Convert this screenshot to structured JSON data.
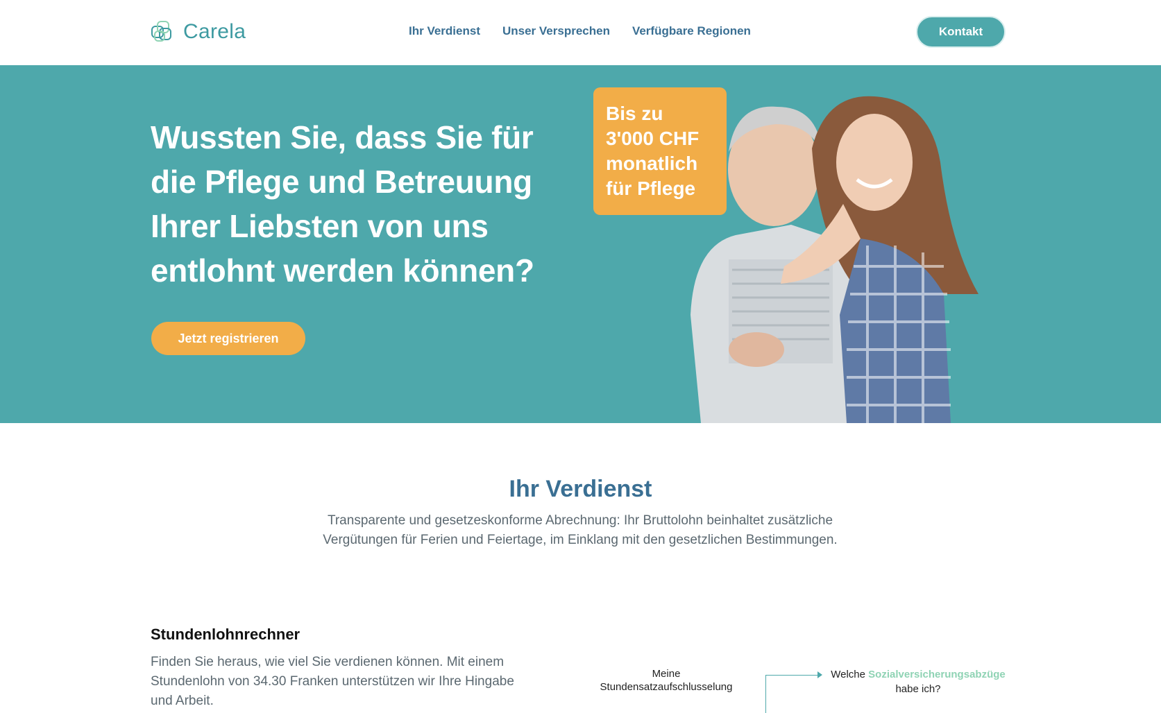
{
  "header": {
    "logo_text": "Carela",
    "nav": [
      "Ihr Verdienst",
      "Unser Versprechen",
      "Verfügbare Regionen"
    ],
    "contact_label": "Kontakt"
  },
  "hero": {
    "title": "Wussten Sie, dass Sie für die Pflege und Betreuung Ihrer Liebsten von uns entlohnt werden können?",
    "register_label": "Jetzt registrieren",
    "badge": "Bis zu 3'000 CHF monatlich für Pflege"
  },
  "earnings": {
    "title": "Ihr Verdienst",
    "text": "Transparente und gesetzeskonforme Abrechnung: Ihr Bruttolohn beinhaltet zusätzliche Vergütungen für Ferien und Feiertage, im Einklang mit den gesetzlichen Bestimmungen."
  },
  "calculator": {
    "title": "Stundenlohnrechner",
    "text": "Finden Sie heraus, wie viel Sie verdienen können. Mit einem Stundenlohn von 34.30 Franken unterstützen wir Ihre Hingabe und Arbeit."
  },
  "diagram": {
    "node_a_line1": "Meine",
    "node_a_line2": "Stundensatzaufschlusselung",
    "node_b_pre": "Welche",
    "node_b_highlight": "Sozialversicherungsabzüge",
    "node_b_post": "habe ich?"
  },
  "colors": {
    "teal": "#4ea8ab",
    "orange": "#f2ad48",
    "heading_blue": "#3a6f93"
  }
}
